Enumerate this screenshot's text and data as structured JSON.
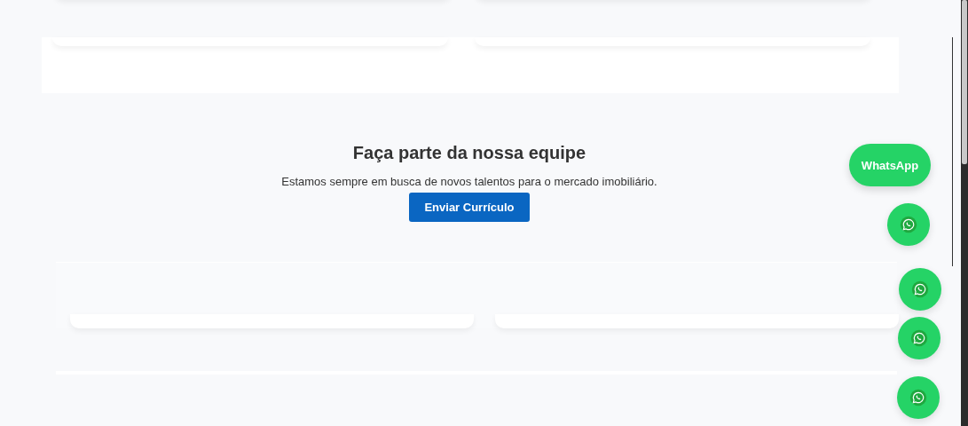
{
  "careers": {
    "heading": "Faça parte da nossa equipe",
    "text": "Estamos sempre em busca de novos talentos para o mercado imobiliário.",
    "button": "Enviar Currículo"
  },
  "whatsapp": {
    "label": "WhatsApp",
    "floating_buttons": [
      {
        "kind": "whatsapp"
      },
      {
        "kind": "whatsapp"
      },
      {
        "kind": "whatsapp"
      },
      {
        "kind": "whatsapp"
      }
    ]
  }
}
